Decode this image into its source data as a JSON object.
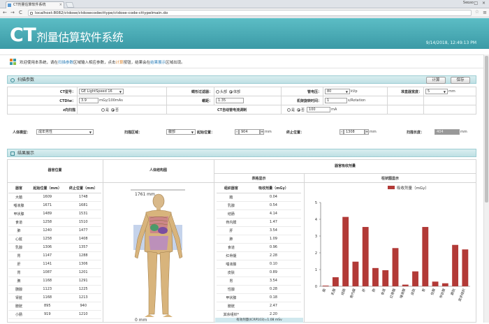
{
  "browser": {
    "tab_title": "CT剂量估算软件系统",
    "tab_close": "×",
    "user": "Senso",
    "window_controls": "–  □  ×",
    "url": "localhost:8082/ctdose/ctdosecodecttype/ctdose-code-cttypelmain.do",
    "back": "←",
    "forward": "→",
    "reload": "C",
    "star": "☆",
    "menu": "≡"
  },
  "app": {
    "title_prefix": "CT",
    "title_rest": "剂量估算软件系统",
    "datetime": "9/14/2018, 12:49:13 PM"
  },
  "welcome": {
    "part1": "欢迎使用本系统，请在",
    "link1": "扫描参数",
    "part2": "区域输入相应参数，点击",
    "link2": "计算",
    "part3": "按钮，结果会在",
    "link3": "结果展示",
    "part4": "区域出现。"
  },
  "scan": {
    "section_title": "扫描参数",
    "calc_button": "计算",
    "save_button": "保存",
    "ct_model_label": "CT型号：",
    "ct_model_value": "GE LightSpeed 16",
    "bowtie_label": "蝶形过滤器：",
    "bowtie_opt1": "头部",
    "bowtie_opt2": "体部",
    "voltage_label": "管电压：",
    "voltage_value": "80",
    "voltage_unit": "kVp",
    "collimation_label": "准直器宽度：",
    "collimation_value": "5",
    "collimation_unit": "mm",
    "ctdiw_label": "CTDIw：",
    "ctdiw_value": "3.9",
    "ctdiw_unit": "mGy/100mAs",
    "pitch_label": "螺距：",
    "pitch_value": "1.35",
    "rotation_label": "机架旋转时间：",
    "rotation_value": "1",
    "rotation_unit": "s/Rotation",
    "zaxis_label": "z向扫描",
    "zaxis_opt1": "是",
    "zaxis_opt2": "否",
    "tcm_label": "CT自动管电流调制",
    "tcm_opt1": "是",
    "tcm_opt2": "否",
    "tcm_value": "100",
    "tcm_unit": "mA",
    "phantom_label": "人体模型：",
    "phantom_value": "成年男性",
    "region_label": "扫描区域：",
    "region_value": "腹部",
    "start_label": "起始位置：",
    "start_value": "904",
    "start_unit": "mm",
    "end_label": "终止位置：",
    "end_value": "1308",
    "end_unit": "mm",
    "length_label": "扫描长度：",
    "length_value": "404",
    "length_unit": "mm",
    "minus": "-",
    "plus": "+"
  },
  "result": {
    "section_title": "结果展示",
    "organ_position_header": "器官位置",
    "organ_col": "器官",
    "start_col": "起始位置（mm）",
    "end_col": "终止位置（mm）",
    "phantom_header": "人体结构图",
    "ruler_top": "1761 mm",
    "ruler_bottom": "0 mm",
    "dose_header": "器官吸收剂量",
    "table_header": "表格显示",
    "chart_header": "柱状图显示",
    "tissue_col": "组织器官",
    "dose_col": "吸收剂量（mGy）",
    "positions": [
      {
        "organ": "大脑",
        "start": "1609",
        "end": "1748"
      },
      {
        "organ": "唾液腺",
        "start": "1671",
        "end": "1681"
      },
      {
        "organ": "甲状腺",
        "start": "1489",
        "end": "1531"
      },
      {
        "organ": "食道",
        "start": "1258",
        "end": "1510"
      },
      {
        "organ": "肺",
        "start": "1240",
        "end": "1477"
      },
      {
        "organ": "心脏",
        "start": "1258",
        "end": "1408"
      },
      {
        "organ": "乳腺",
        "start": "1306",
        "end": "1357"
      },
      {
        "organ": "胃",
        "start": "1147",
        "end": "1288"
      },
      {
        "organ": "肝",
        "start": "1141",
        "end": "1306"
      },
      {
        "organ": "胃",
        "start": "1087",
        "end": "1201"
      },
      {
        "organ": "脾",
        "start": "1168",
        "end": "1291"
      },
      {
        "organ": "胰腺",
        "start": "1123",
        "end": "1225"
      },
      {
        "organ": "肾脏",
        "start": "1168",
        "end": "1213"
      },
      {
        "organ": "膀胱",
        "start": "895",
        "end": "940"
      },
      {
        "organ": "小肠",
        "start": "919",
        "end": "1210"
      }
    ],
    "doses": [
      {
        "organ": "脑",
        "dose": "0.04"
      },
      {
        "organ": "乳腺",
        "dose": "0.54"
      },
      {
        "organ": "结肠",
        "dose": "4.14"
      },
      {
        "organ": "骨内膜",
        "dose": "1.47"
      },
      {
        "organ": "肝",
        "dose": "3.54"
      },
      {
        "organ": "肺",
        "dose": "1.09"
      },
      {
        "organ": "食道",
        "dose": "0.96"
      },
      {
        "organ": "红骨髓",
        "dose": "2.28"
      },
      {
        "organ": "唾液腺",
        "dose": "0.10"
      },
      {
        "organ": "皮肤",
        "dose": "0.89"
      },
      {
        "organ": "胃",
        "dose": "3.54"
      },
      {
        "organ": "性腺",
        "dose": "0.28"
      },
      {
        "organ": "甲状腺",
        "dose": "0.18"
      },
      {
        "organ": "膀胱",
        "dose": "2.47"
      },
      {
        "organ": "其余组织*",
        "dose": "2.20"
      }
    ],
    "footnote": "有效剂量(ICRP103)=1.08 mSv"
  },
  "chart_data": {
    "type": "bar",
    "legend": "吸收剂量（mGy）",
    "legend_position": "top",
    "categories": [
      "脑",
      "乳腺",
      "结肠",
      "骨内膜",
      "肝",
      "肺",
      "食道",
      "红骨髓",
      "唾液腺",
      "皮肤",
      "胃",
      "性腺",
      "甲状腺",
      "膀胱",
      "其余组织"
    ],
    "values": [
      0.04,
      0.54,
      4.14,
      1.47,
      3.54,
      1.09,
      0.96,
      2.28,
      0.1,
      0.89,
      3.54,
      0.28,
      0.18,
      2.47,
      2.2
    ],
    "ylim": [
      0,
      5
    ],
    "yticks": [
      "0",
      "1",
      "2",
      "3",
      "4",
      "5"
    ],
    "grid": false,
    "bar_color": "#b23a37"
  }
}
